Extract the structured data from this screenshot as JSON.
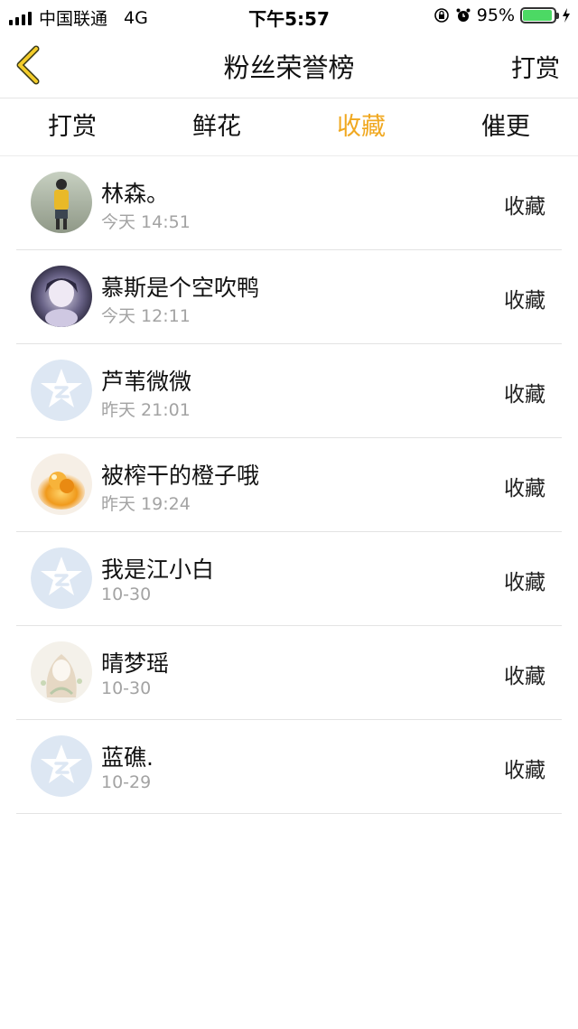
{
  "status_bar": {
    "carrier": "中国联通",
    "network": "4G",
    "time": "下午5:57",
    "battery": "95%",
    "battery_level": 0.95
  },
  "nav": {
    "back_icon": "chevron-left-icon",
    "title": "粉丝荣誉榜",
    "right_label": "打赏"
  },
  "tabs": [
    {
      "label": "打赏",
      "active": false
    },
    {
      "label": "鲜花",
      "active": false
    },
    {
      "label": "收藏",
      "active": true
    },
    {
      "label": "催更",
      "active": false
    }
  ],
  "colors": {
    "accent": "#f0a820",
    "battery_green": "#4cd964",
    "placeholder_avatar": "#dde7f3"
  },
  "fans": [
    {
      "name": "林森。",
      "time": "今天 14:51",
      "action": "收藏",
      "avatar": "photo-person-yellow"
    },
    {
      "name": "慕斯是个空吹鸭",
      "time": "今天 12:11",
      "action": "收藏",
      "avatar": "photo-anime-dark"
    },
    {
      "name": "芦苇微微",
      "time": "昨天 21:01",
      "action": "收藏",
      "avatar": "default-qq-star"
    },
    {
      "name": "被榨干的橙子哦",
      "time": "昨天 19:24",
      "action": "收藏",
      "avatar": "photo-orange"
    },
    {
      "name": "我是江小白",
      "time": "10-30",
      "action": "收藏",
      "avatar": "default-qq-star"
    },
    {
      "name": "晴梦瑶",
      "time": "10-30",
      "action": "收藏",
      "avatar": "photo-anime-sketch"
    },
    {
      "name": "蓝礁.",
      "time": "10-29",
      "action": "收藏",
      "avatar": "default-qq-star"
    }
  ]
}
